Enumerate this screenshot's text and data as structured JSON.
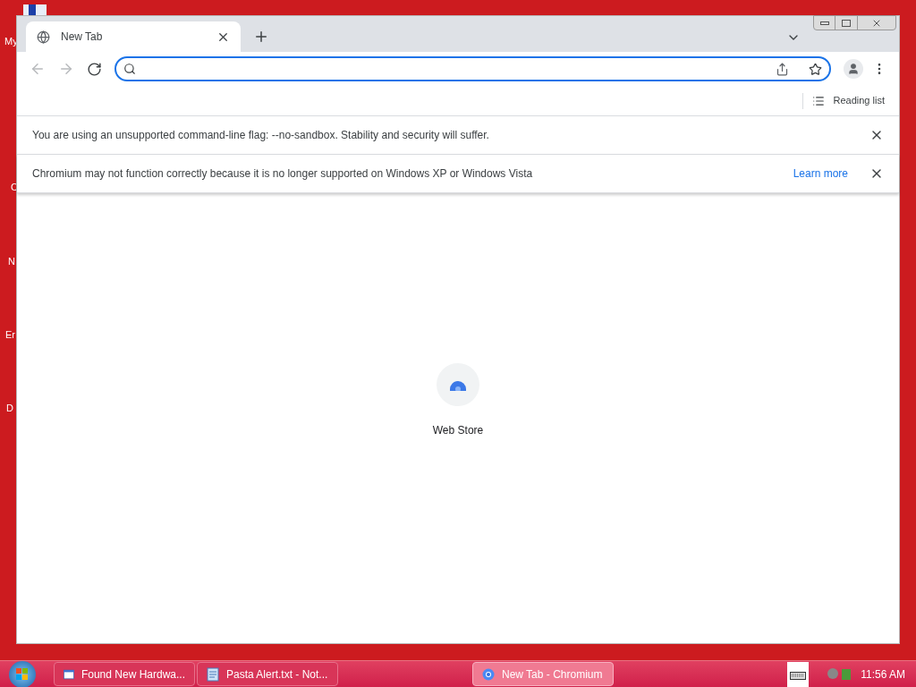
{
  "desktop_icons": [
    {
      "label": "My"
    },
    {
      "label": "C"
    },
    {
      "label": "N"
    },
    {
      "label": "Er"
    },
    {
      "label": "D"
    }
  ],
  "window": {
    "tabs": [
      {
        "title": "New Tab",
        "selected": true
      }
    ],
    "bookmarks_bar": {
      "reading_list": "Reading list"
    },
    "infobars": [
      {
        "message": "You are using an unsupported command-line flag: --no-sandbox. Stability and security will suffer."
      },
      {
        "message": "Chromium may not function correctly because it is no longer supported on Windows XP or Windows Vista",
        "link": "Learn more"
      }
    ],
    "shortcuts": [
      {
        "label": "Web Store"
      }
    ]
  },
  "taskbar": {
    "buttons": [
      {
        "label": "Found New Hardwa...",
        "kind": "window",
        "selected": false
      },
      {
        "label": "Pasta Alert.txt - Not...",
        "kind": "notepad",
        "selected": false
      },
      {
        "label": "New Tab - Chromium",
        "kind": "chromium",
        "selected": true
      }
    ],
    "clock": "11:56 AM"
  }
}
